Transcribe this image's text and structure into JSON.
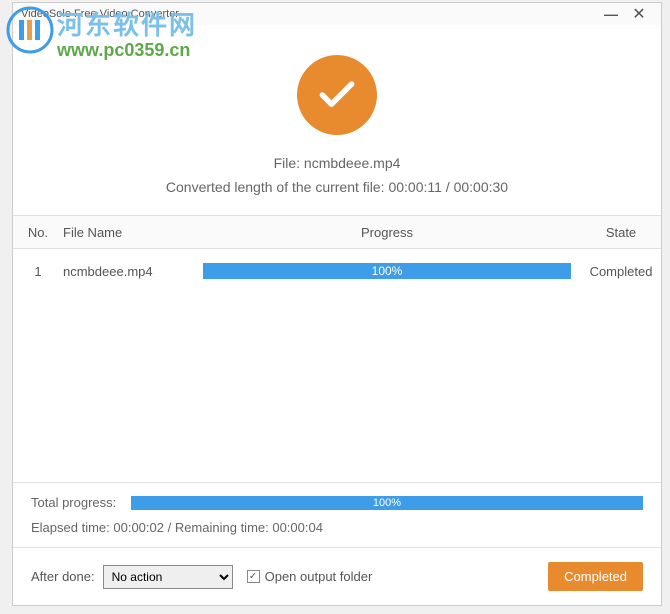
{
  "watermark": {
    "text": "河东软件网",
    "url": "www.pc0359.cn"
  },
  "window": {
    "title": "VideoSolo Free Video Converter"
  },
  "header": {
    "file_label": "File: ncmbdeee.mp4",
    "length_label": "Converted length of the current file: 00:00:11 / 00:00:30"
  },
  "table": {
    "headers": {
      "no": "No.",
      "filename": "File Name",
      "progress": "Progress",
      "state": "State"
    },
    "rows": [
      {
        "no": "1",
        "filename": "ncmbdeee.mp4",
        "progress_pct": "100%",
        "state": "Completed"
      }
    ]
  },
  "footer": {
    "total_label": "Total progress:",
    "total_pct": "100%",
    "times": "Elapsed time: 00:00:02 / Remaining time: 00:00:04",
    "after_done": "After done:",
    "after_select": "No action",
    "open_folder": "Open output folder",
    "completed_btn": "Completed"
  }
}
